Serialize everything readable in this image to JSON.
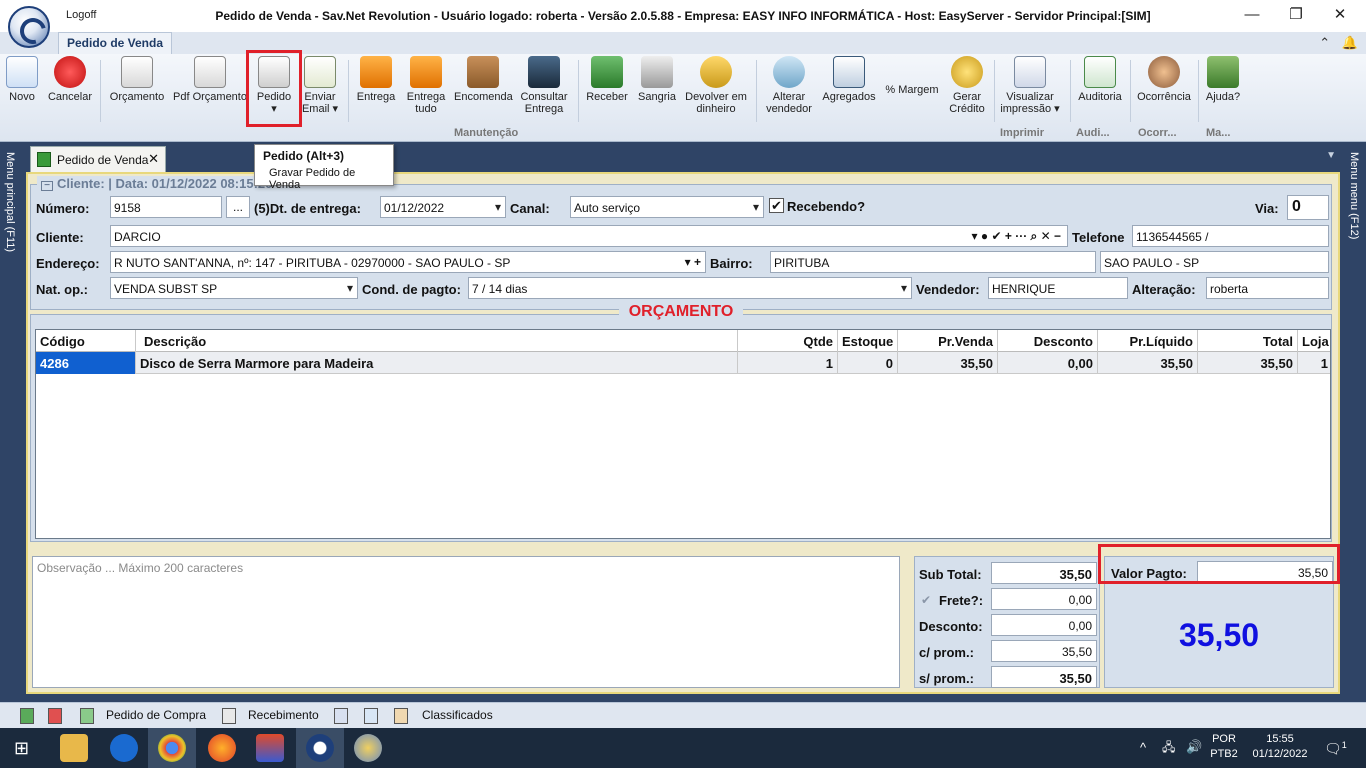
{
  "window": {
    "logoff": "Logoff",
    "title": "Pedido de Venda - Sav.Net Revolution - Usuário logado: roberta - Versão 2.0.5.88 - Empresa: EASY INFO INFORMÁTICA - Host: EasyServer - Servidor Principal:[SIM]"
  },
  "ribbon": {
    "tab": "Pedido de Venda",
    "buttons": {
      "novo": "Novo",
      "cancelar": "Cancelar",
      "orcamento": "Orçamento",
      "pdf_orcamento": "Pdf Orçamento",
      "pedido": "Pedido",
      "enviar_email_1": "Enviar",
      "enviar_email_2": "Email ▾",
      "entrega": "Entrega",
      "entrega_tudo_1": "Entrega",
      "entrega_tudo_2": "tudo",
      "encomenda": "Encomenda",
      "consultar_entrega_1": "Consultar",
      "consultar_entrega_2": "Entrega",
      "receber": "Receber",
      "sangria": "Sangria",
      "devolver_1": "Devolver em",
      "devolver_2": "dinheiro",
      "alterar_vendedor_1": "Alterar",
      "alterar_vendedor_2": "vendedor",
      "agregados": "Agregados",
      "margem": "% Margem",
      "gerar_credito_1": "Gerar",
      "gerar_credito_2": "Crédito",
      "visualizar_1": "Visualizar",
      "visualizar_2": "impressão ▾",
      "auditoria": "Auditoria",
      "ocorrencia": "Ocorrência",
      "ajuda": "Ajuda?"
    },
    "groups": {
      "manutencao": "Manutenção",
      "imprimir": "Imprimir",
      "audi": "Audi...",
      "ocorr": "Ocorr...",
      "ma": "Ma..."
    }
  },
  "tooltip": {
    "title": "Pedido (Alt+3)",
    "desc": "Gravar Pedido de Venda"
  },
  "side": {
    "left": "Menu principal (F11)",
    "right": "Menu menu (F12)"
  },
  "doc_tab": "Pedido de Venda",
  "form": {
    "legend": "Cliente:  | Data: 01/12/2022 08:15:20",
    "numero_label": "Número:",
    "numero": "9158",
    "dots": "...",
    "dt_label": "(5)Dt. de entrega:",
    "dt": "01/12/2022",
    "canal_label": "Canal:",
    "canal": "Auto serviço",
    "recebendo_label": "Recebendo?",
    "via_label": "Via:",
    "via": "0",
    "cliente_label": "Cliente:",
    "cliente": "DARCIO",
    "cliente_tools": "▾ ● ✔ + ··· ⌕ ✕ −",
    "telefone_label": "Telefone",
    "telefone": "1136544565 /",
    "endereco_label": "Endereço:",
    "endereco": "R NUTO SANT'ANNA, nº: 147 - PIRITUBA - 02970000 - SAO PAULO - SP",
    "endereco_tools": "▾ +",
    "bairro_label": "Bairro:",
    "bairro": "PIRITUBA",
    "cidade": "SAO PAULO - SP",
    "natop_label": "Nat. op.:",
    "natop": "VENDA SUBST SP",
    "cond_label": "Cond. de pagto:",
    "cond": "7 / 14 dias",
    "vendedor_label": "Vendedor:",
    "vendedor": "HENRIQUE",
    "alteracao_label": "Alteração:",
    "alteracao": "roberta"
  },
  "grid": {
    "title": "ORÇAMENTO",
    "headers": [
      "Código",
      "Descrição",
      "Qtde",
      "Estoque",
      "Pr.Venda",
      "Desconto",
      "Pr.Líquido",
      "Total",
      "Loja"
    ],
    "rows": [
      [
        "4286",
        "Disco de Serra Marmore para Madeira",
        "1",
        "0",
        "35,50",
        "0,00",
        "35,50",
        "35,50",
        "1"
      ]
    ]
  },
  "obs_placeholder": "Observação ... Máximo 200 caracteres",
  "totals": {
    "subtotal_label": "Sub Total:",
    "subtotal": "35,50",
    "frete_label": "Frete?:",
    "frete": "0,00",
    "desconto_label": "Desconto:",
    "desconto": "0,00",
    "cprom_label": "c/ prom.:",
    "cprom": "35,50",
    "sprom_label": "s/ prom.:",
    "sprom": "35,50"
  },
  "pagamento": {
    "label": "Valor Pagto:",
    "value": "35,50",
    "big": "35,50"
  },
  "bottom_bar": {
    "pedido_compra": "Pedido de Compra",
    "recebimento": "Recebimento",
    "classificados": "Classificados"
  },
  "taskbar": {
    "lang1": "POR",
    "lang2": "PTB2",
    "time": "15:55",
    "date": "01/12/2022",
    "notif": "1"
  },
  "colors": {
    "highlight": "#e0202a",
    "big_total": "#1010e0",
    "panel": "#d6e0ec",
    "dark_frame": "#2f4466"
  }
}
